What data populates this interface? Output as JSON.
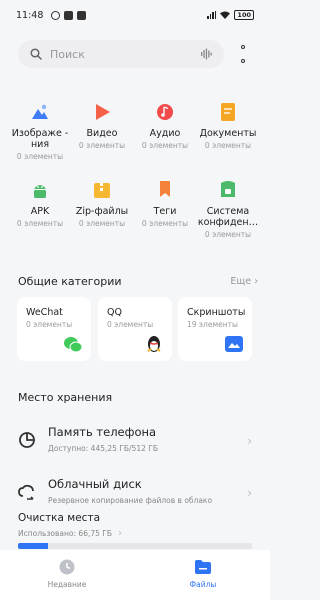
{
  "status_bar": {
    "time": "11:48",
    "battery": "100"
  },
  "search": {
    "placeholder": "Поиск"
  },
  "categories": [
    {
      "label": "Изображе -\nния",
      "count": "0 элементы",
      "color": "#3d7bf7",
      "icon": "image-icon"
    },
    {
      "label": "Видео",
      "count": "0 элементы",
      "color": "#f5614a",
      "icon": "video-icon"
    },
    {
      "label": "Аудио",
      "count": "0 элементы",
      "color": "#f04a4a",
      "icon": "audio-icon"
    },
    {
      "label": "Документы",
      "count": "0 элементы",
      "color": "#f5a623",
      "icon": "document-icon"
    },
    {
      "label": "APK",
      "count": "0 элементы",
      "color": "#4cba6a",
      "icon": "android-icon"
    },
    {
      "label": "Zip-файлы",
      "count": "0 элементы",
      "color": "#f7b733",
      "icon": "zip-icon"
    },
    {
      "label": "Теги",
      "count": "0 элементы",
      "color": "#f5823a",
      "icon": "tag-icon"
    },
    {
      "label": "Система\nконфиден…",
      "count": "0 элементы",
      "color": "#4cba6a",
      "icon": "privacy-icon"
    }
  ],
  "common": {
    "title": "Общие категории",
    "more": "Еще",
    "items": [
      {
        "title": "WeChat",
        "count": "0 элементы",
        "icon": "wechat-icon",
        "color": "#3fca5a"
      },
      {
        "title": "QQ",
        "count": "0 элементы",
        "icon": "qq-icon",
        "color": "#222222"
      },
      {
        "title": "Скриншоты",
        "count": "19 элементы",
        "icon": "screenshot-icon",
        "color": "#2f74f5"
      }
    ]
  },
  "storage": {
    "title": "Место хранения",
    "phone": {
      "title": "Память телефона",
      "subtitle": "Доступно: 445,25 ГБ/512 ГБ"
    },
    "cloud": {
      "title": "Облачный диск",
      "subtitle": "Резервное копирование файлов в облако"
    }
  },
  "cleanup": {
    "title": "Очистка места",
    "used": "Использовано: 66,75 ГБ",
    "used_fraction": 0.13
  },
  "tabs": {
    "recent": "Недавние",
    "files": "Файлы"
  },
  "colors": {
    "accent": "#2f74f5"
  }
}
